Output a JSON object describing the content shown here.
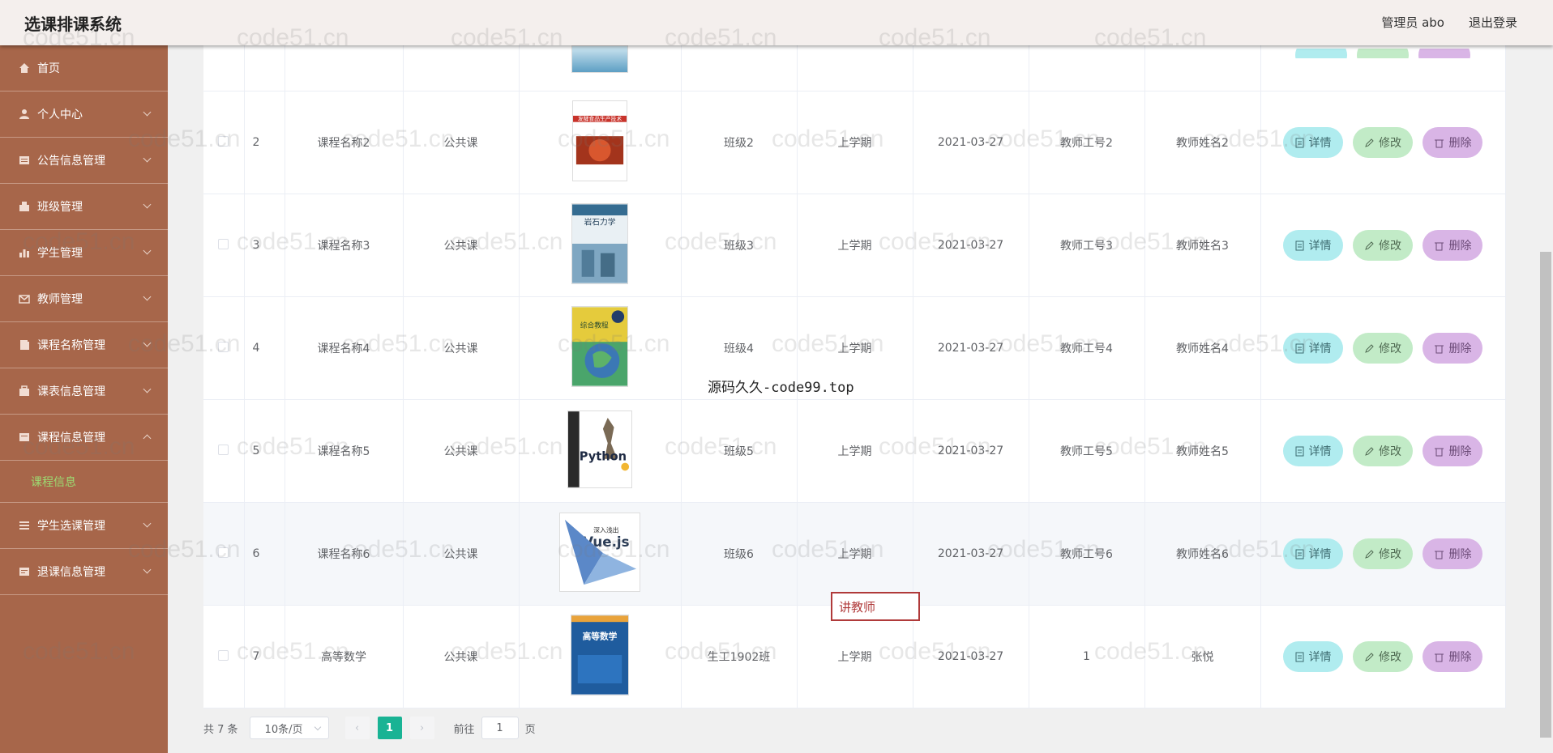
{
  "header": {
    "title": "选课排课系统",
    "user": "管理员 abo",
    "logout": "退出登录"
  },
  "sidebar": {
    "items": [
      {
        "label": "首页",
        "icon": "home-icon",
        "has_children": false
      },
      {
        "label": "个人中心",
        "icon": "user-icon",
        "has_children": true
      },
      {
        "label": "公告信息管理",
        "icon": "notice-icon",
        "has_children": true
      },
      {
        "label": "班级管理",
        "icon": "class-icon",
        "has_children": true
      },
      {
        "label": "学生管理",
        "icon": "student-icon",
        "has_children": true
      },
      {
        "label": "教师管理",
        "icon": "mail-icon",
        "has_children": true
      },
      {
        "label": "课程名称管理",
        "icon": "book-icon",
        "has_children": true
      },
      {
        "label": "课表信息管理",
        "icon": "schedule-icon",
        "has_children": true
      },
      {
        "label": "课程信息管理",
        "icon": "course-icon",
        "has_children": true
      },
      {
        "label": "学生选课管理",
        "icon": "select-icon",
        "has_children": true
      },
      {
        "label": "退课信息管理",
        "icon": "withdraw-icon",
        "has_children": true
      }
    ],
    "active_sub": "课程信息"
  },
  "table": {
    "rows": [
      {
        "index": "2",
        "course": "课程名称2",
        "type": "公共课",
        "cover": "book-cover-red",
        "class": "班级2",
        "term": "上学期",
        "date": "2021-03-27",
        "teacher_id": "教师工号2",
        "teacher_name": "教师姓名2"
      },
      {
        "index": "3",
        "course": "课程名称3",
        "type": "公共课",
        "cover": "book-cover-blue",
        "class": "班级3",
        "term": "上学期",
        "date": "2021-03-27",
        "teacher_id": "教师工号3",
        "teacher_name": "教师姓名3"
      },
      {
        "index": "4",
        "course": "课程名称4",
        "type": "公共课",
        "cover": "book-cover-green",
        "class": "班级4",
        "term": "上学期",
        "date": "2021-03-27",
        "teacher_id": "教师工号4",
        "teacher_name": "教师姓名4"
      },
      {
        "index": "5",
        "course": "课程名称5",
        "type": "公共课",
        "cover": "book-cover-python",
        "class": "班级5",
        "term": "上学期",
        "date": "2021-03-27",
        "teacher_id": "教师工号5",
        "teacher_name": "教师姓名5"
      },
      {
        "index": "6",
        "course": "课程名称6",
        "type": "公共课",
        "cover": "book-cover-vue",
        "class": "班级6",
        "term": "上学期",
        "date": "2021-03-27",
        "teacher_id": "教师工号6",
        "teacher_name": "教师姓名6"
      },
      {
        "index": "7",
        "course": "高等数学",
        "type": "公共课",
        "cover": "book-cover-math",
        "class": "生工1902班",
        "term": "上学期",
        "date": "2021-03-27",
        "teacher_id": "1",
        "teacher_name": "张悦"
      }
    ],
    "actions": {
      "detail": "详情",
      "edit": "修改",
      "delete": "删除"
    }
  },
  "covers": {
    "red_title": "发酵食品生产技术",
    "blue_title": "岩石力学",
    "green_title": "综合教程",
    "python_title": "Python",
    "vue_title": "Vue.js",
    "vue_sub": "深入浅出",
    "math_title": "高等数学"
  },
  "pagination": {
    "total": "共 7 条",
    "page_size": "10条/页",
    "current_page": "1",
    "goto_label": "前往",
    "goto_value": "1",
    "page_suffix": "页"
  },
  "tooltip": "讲教师",
  "overlay": "源码久久-code99.top",
  "watermark": "code51.cn",
  "colors": {
    "sidebar_bg": "#a7664a",
    "header_bg": "#f4efed",
    "accent": "#19b394",
    "detail_btn": "#b0ecef",
    "edit_btn": "#c2ebc7",
    "delete_btn": "#d9b5e6"
  }
}
